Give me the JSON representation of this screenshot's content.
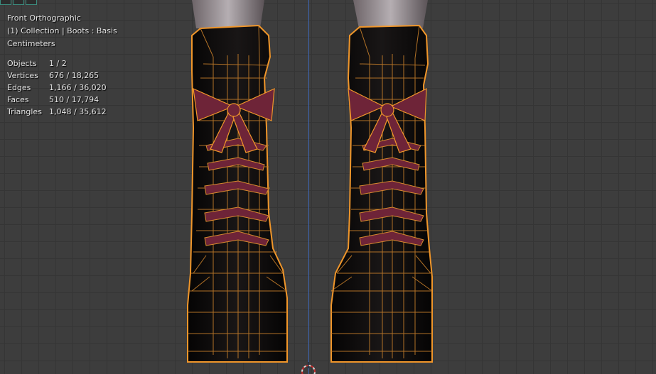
{
  "view": {
    "title": "Front Orthographic",
    "collection": "(1) Collection | Boots : Basis",
    "units": "Centimeters"
  },
  "stats": [
    {
      "label": "Objects",
      "value": "1 / 2"
    },
    {
      "label": "Vertices",
      "value": "676 / 18,265"
    },
    {
      "label": "Edges",
      "value": "1,166 / 36,020"
    },
    {
      "label": "Faces",
      "value": "510 / 17,794"
    },
    {
      "label": "Triangles",
      "value": "1,048 / 35,612"
    }
  ],
  "colors": {
    "grid": "#3d3d3d",
    "selection_outline": "#f0962a",
    "wire": "#d68a2e",
    "boot": "#0e0c0c",
    "lace": "#6e2438",
    "leg": "#8f868c",
    "y_axis": "#3f67b5"
  },
  "icons": {
    "cursor": "3d-cursor-icon",
    "header_chips": "header-buttons"
  }
}
